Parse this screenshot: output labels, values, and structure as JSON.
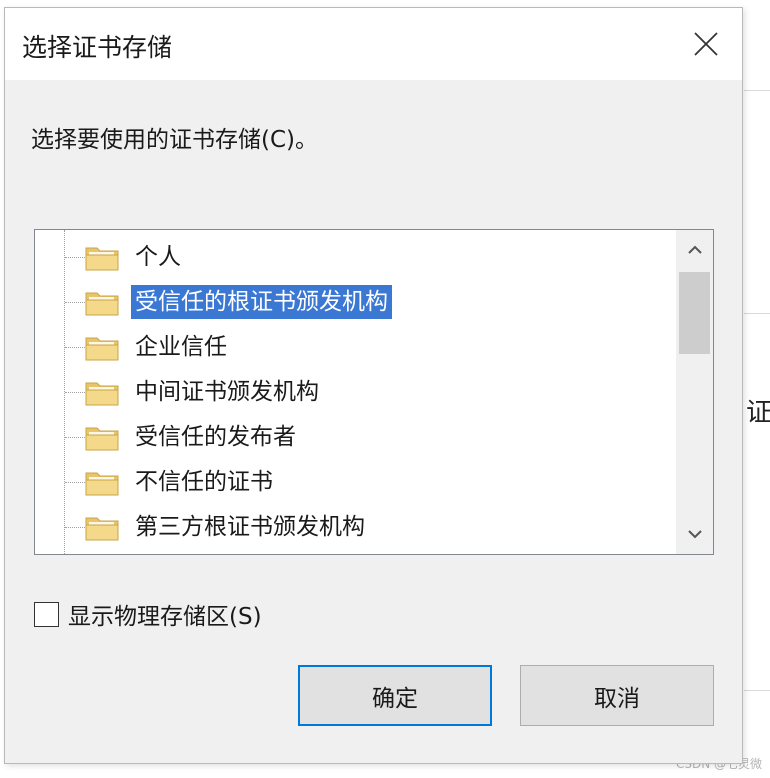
{
  "dialog": {
    "title": "选择证书存储",
    "prompt": "选择要使用的证书存储(C)。",
    "close_icon": "close-icon"
  },
  "tree": {
    "items": [
      {
        "label": "个人",
        "selected": false
      },
      {
        "label": "受信任的根证书颁发机构",
        "selected": true
      },
      {
        "label": "企业信任",
        "selected": false
      },
      {
        "label": "中间证书颁发机构",
        "selected": false
      },
      {
        "label": "受信任的发布者",
        "selected": false
      },
      {
        "label": "不信任的证书",
        "selected": false
      },
      {
        "label": "第三方根证书颁发机构",
        "selected": false
      }
    ],
    "selection_color": "#3a78d4",
    "folder_icon": "folder-icon"
  },
  "options": {
    "show_physical_label": "显示物理存储区(S)",
    "show_physical_checked": false
  },
  "buttons": {
    "ok_label": "确定",
    "cancel_label": "取消",
    "accent": "#0078d7"
  },
  "background": {
    "partial_text": "证书"
  },
  "watermark": {
    "text": "CSDN @七灵微"
  }
}
